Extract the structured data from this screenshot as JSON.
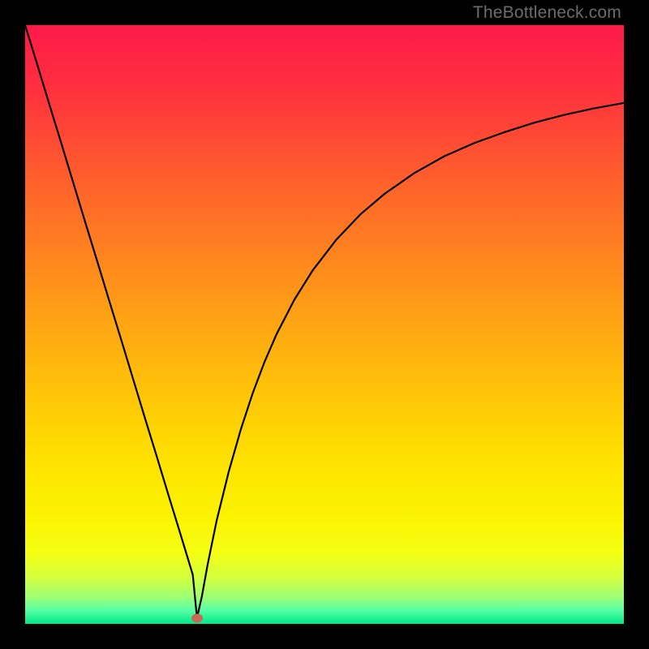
{
  "watermark": {
    "text": "TheBottleneck.com"
  },
  "gradient_stops": [
    {
      "offset": 0.0,
      "color": "#ff1a49"
    },
    {
      "offset": 0.1,
      "color": "#ff2e3e"
    },
    {
      "offset": 0.22,
      "color": "#ff5430"
    },
    {
      "offset": 0.35,
      "color": "#ff7a22"
    },
    {
      "offset": 0.48,
      "color": "#ffa015"
    },
    {
      "offset": 0.6,
      "color": "#ffc008"
    },
    {
      "offset": 0.72,
      "color": "#ffe000"
    },
    {
      "offset": 0.82,
      "color": "#fbf300"
    },
    {
      "offset": 0.88,
      "color": "#f6ff13"
    },
    {
      "offset": 0.92,
      "color": "#d6ff3a"
    },
    {
      "offset": 0.955,
      "color": "#9fff74"
    },
    {
      "offset": 0.978,
      "color": "#55ffa6"
    },
    {
      "offset": 1.0,
      "color": "#00e884"
    }
  ],
  "marker": {
    "x_frac": 0.287,
    "color": "#cb6854"
  },
  "chart_data": {
    "type": "line",
    "title": "",
    "xlabel": "",
    "ylabel": "",
    "xlim": [
      0,
      100
    ],
    "ylim": [
      0,
      100
    ],
    "notes": "V-shaped bottleneck curve with minimum near x≈28.7. Values are percentage-of-plot-height estimates read from the image.",
    "series": [
      {
        "name": "bottleneck-curve",
        "x": [
          0,
          2,
          4,
          6,
          8,
          10,
          12,
          14,
          16,
          18,
          20,
          22,
          24,
          26,
          27,
          28,
          28.7,
          29.5,
          30.5,
          32,
          34,
          36,
          38,
          40,
          42,
          45,
          48,
          52,
          56,
          60,
          65,
          70,
          75,
          80,
          85,
          90,
          95,
          100
        ],
        "y": [
          100,
          93.5,
          86.9,
          80.4,
          73.8,
          67.2,
          60.7,
          54.1,
          47.6,
          41.0,
          34.4,
          27.9,
          21.3,
          14.8,
          11.5,
          8.2,
          1.0,
          4.5,
          10.0,
          17.3,
          25.4,
          32.4,
          38.5,
          43.8,
          48.4,
          54.2,
          59.0,
          64.2,
          68.4,
          71.8,
          75.3,
          78.1,
          80.3,
          82.1,
          83.7,
          85.0,
          86.1,
          87.0
        ]
      }
    ],
    "marker_point": {
      "x": 28.7,
      "y": 1.0
    }
  }
}
